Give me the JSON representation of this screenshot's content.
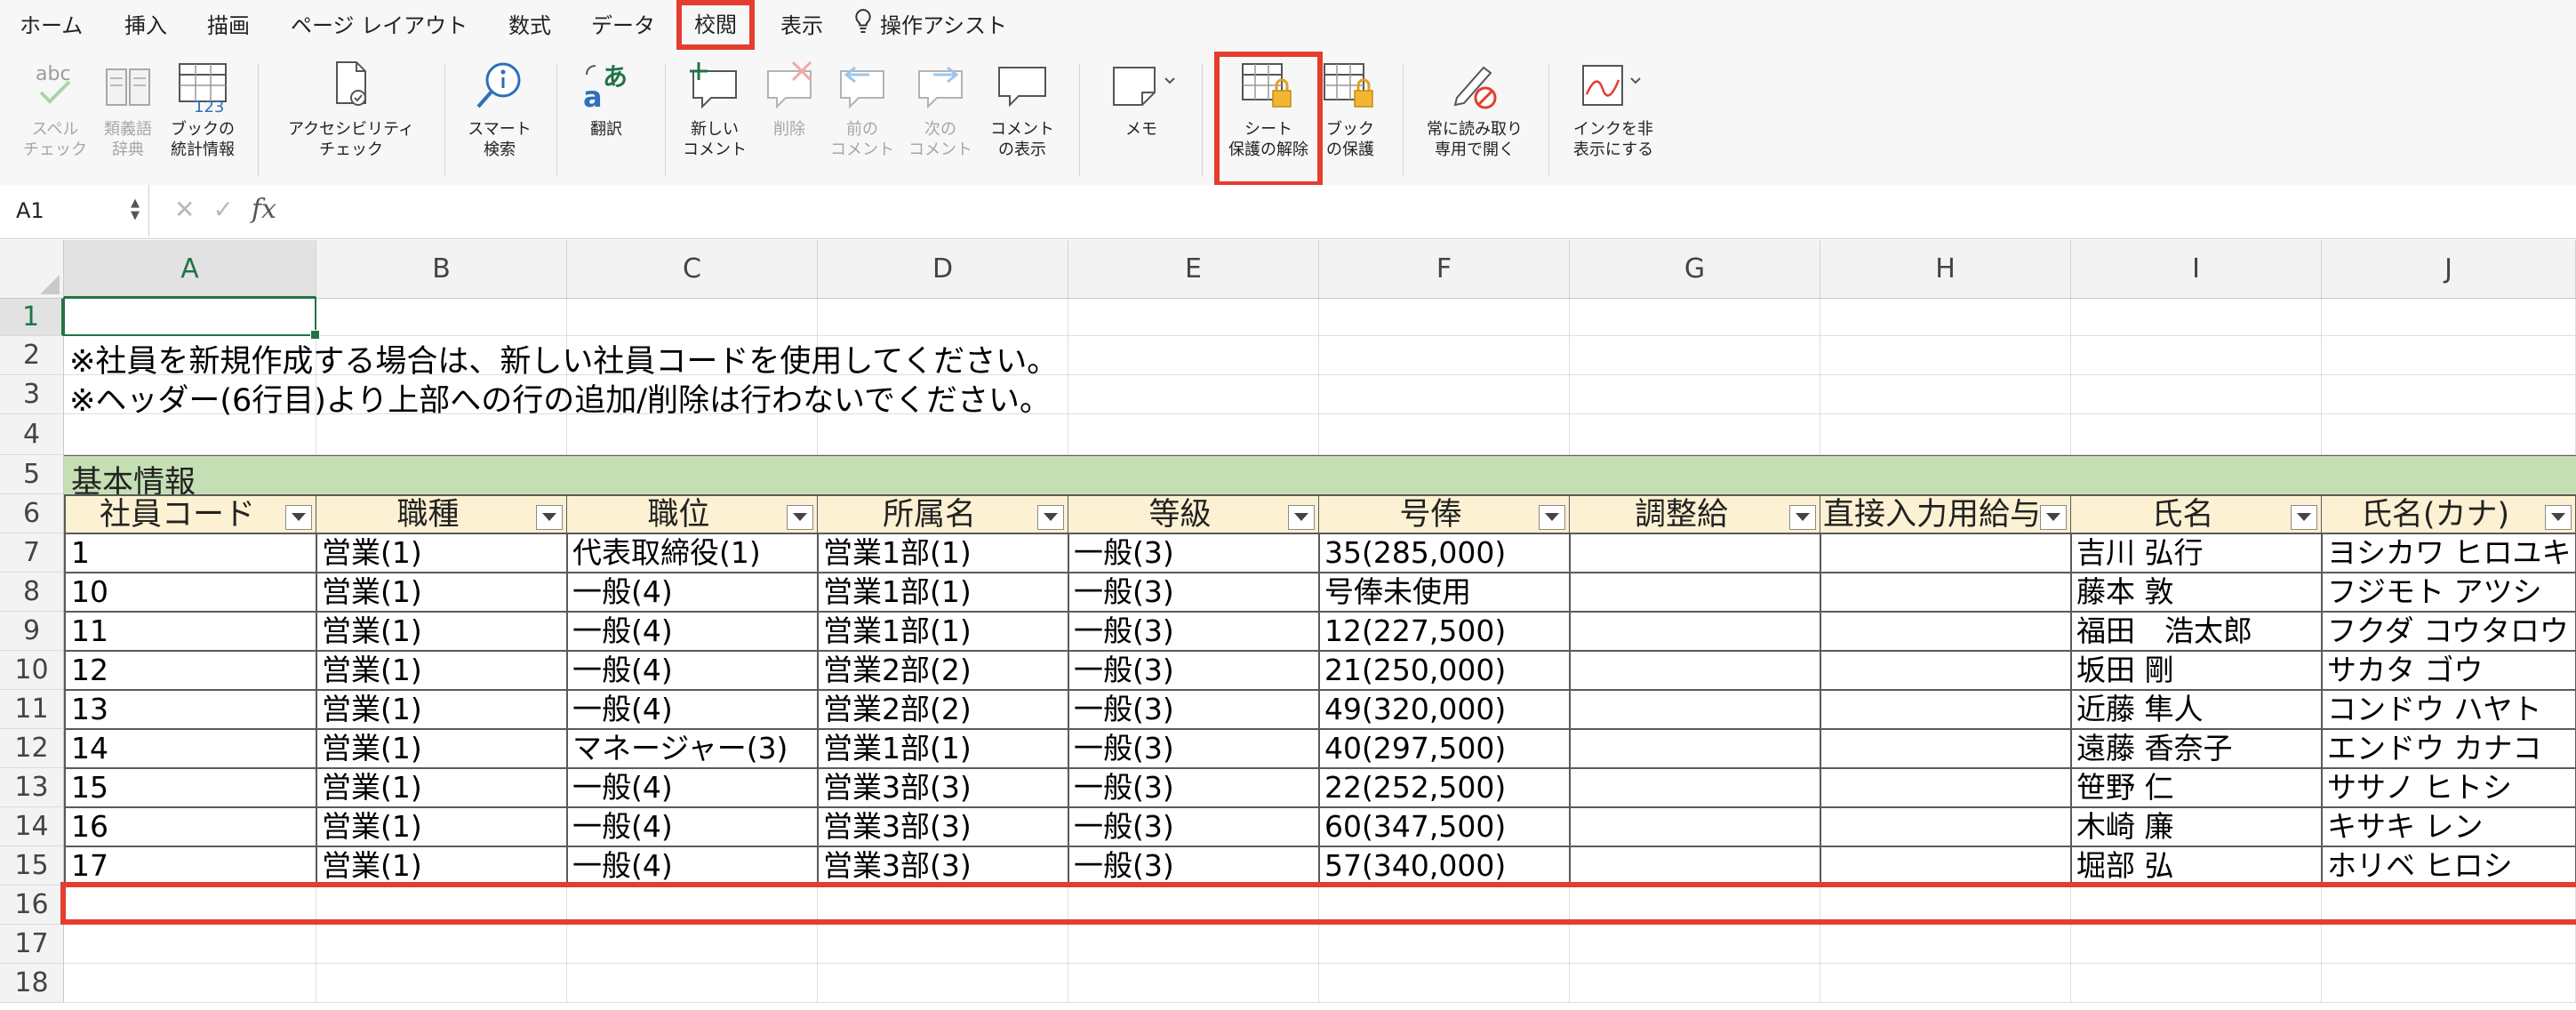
{
  "tabs": [
    {
      "label": "ホーム"
    },
    {
      "label": "挿入"
    },
    {
      "label": "描画"
    },
    {
      "label": "ページ レイアウト"
    },
    {
      "label": "数式"
    },
    {
      "label": "データ"
    },
    {
      "label": "校閲"
    },
    {
      "label": "表示"
    },
    {
      "label": "操作アシスト"
    }
  ],
  "ribbon": {
    "spelling": {
      "line1": "スペル",
      "line2": "チェック"
    },
    "thesaurus": {
      "line1": "類義語",
      "line2": "辞典"
    },
    "stats": {
      "line1": "ブックの",
      "line2": "統計情報"
    },
    "accessibility": {
      "line1": "アクセシビリティ",
      "line2": "チェック"
    },
    "smart_lookup": {
      "line1": "スマート",
      "line2": "検索"
    },
    "translate": {
      "line1": "翻訳"
    },
    "new_comment": {
      "line1": "新しい",
      "line2": "コメント"
    },
    "delete": {
      "line1": "削除"
    },
    "prev_comment": {
      "line1": "前の",
      "line2": "コメント"
    },
    "next_comment": {
      "line1": "次の",
      "line2": "コメント"
    },
    "show_comments": {
      "line1": "コメント",
      "line2": "の表示"
    },
    "memo": {
      "line1": "メモ"
    },
    "unprotect_sheet": {
      "line1": "シート",
      "line2": "保護の解除"
    },
    "protect_book": {
      "line1": "ブック",
      "line2": "の保護"
    },
    "read_only": {
      "line1": "常に読み取り",
      "line2": "専用で開く"
    },
    "hide_ink": {
      "line1": "インクを非",
      "line2": "表示にする"
    }
  },
  "formula_bar": {
    "name_box": "A1",
    "fx": "fx",
    "formula": ""
  },
  "columns": [
    "A",
    "B",
    "C",
    "D",
    "E",
    "F",
    "G",
    "H",
    "I",
    "J"
  ],
  "rows": [
    "1",
    "2",
    "3",
    "4",
    "5",
    "6",
    "7",
    "8",
    "9",
    "10",
    "11",
    "12",
    "13",
    "14",
    "15",
    "16",
    "17",
    "18"
  ],
  "notes": {
    "row2": "※社員を新規作成する場合は、新しい社員コードを使用してください。",
    "row3": "※ヘッダー(6行目)より上部への行の追加/削除は行わないでください。"
  },
  "section_title": "基本情報",
  "table": {
    "headers": [
      "社員コード",
      "職種",
      "職位",
      "所属名",
      "等級",
      "号俸",
      "調整給",
      "直接入力用給与",
      "氏名",
      "氏名(カナ)"
    ],
    "rows": [
      [
        "1",
        "営業(1)",
        "代表取締役(1)",
        "営業1部(1)",
        "一般(3)",
        "35(285,000)",
        "",
        "",
        "吉川 弘行",
        "ヨシカワ ヒロユキ"
      ],
      [
        "10",
        "営業(1)",
        "一般(4)",
        "営業1部(1)",
        "一般(3)",
        "号俸未使用",
        "",
        "",
        "藤本 敦",
        "フジモト アツシ"
      ],
      [
        "11",
        "営業(1)",
        "一般(4)",
        "営業1部(1)",
        "一般(3)",
        "12(227,500)",
        "",
        "",
        "福田　浩太郎",
        "フクダ コウタロウ"
      ],
      [
        "12",
        "営業(1)",
        "一般(4)",
        "営業2部(2)",
        "一般(3)",
        "21(250,000)",
        "",
        "",
        "坂田 剛",
        "サカタ ゴウ"
      ],
      [
        "13",
        "営業(1)",
        "一般(4)",
        "営業2部(2)",
        "一般(3)",
        "49(320,000)",
        "",
        "",
        "近藤 隼人",
        "コンドウ ハヤト"
      ],
      [
        "14",
        "営業(1)",
        "マネージャー(3)",
        "営業1部(1)",
        "一般(3)",
        "40(297,500)",
        "",
        "",
        "遠藤 香奈子",
        "エンドウ カナコ"
      ],
      [
        "15",
        "営業(1)",
        "一般(4)",
        "営業3部(3)",
        "一般(3)",
        "22(252,500)",
        "",
        "",
        "笹野 仁",
        "ササノ ヒトシ"
      ],
      [
        "16",
        "営業(1)",
        "一般(4)",
        "営業3部(3)",
        "一般(3)",
        "60(347,500)",
        "",
        "",
        "木崎 廉",
        "キサキ レン"
      ],
      [
        "17",
        "営業(1)",
        "一般(4)",
        "営業3部(3)",
        "一般(3)",
        "57(340,000)",
        "",
        "",
        "堀部 弘",
        "ホリベ ヒロシ"
      ]
    ]
  },
  "colors": {
    "highlight": "#e43d2f",
    "band": "#c5dfb4",
    "header_fill": "#fdf1d3",
    "selection": "#217346"
  }
}
